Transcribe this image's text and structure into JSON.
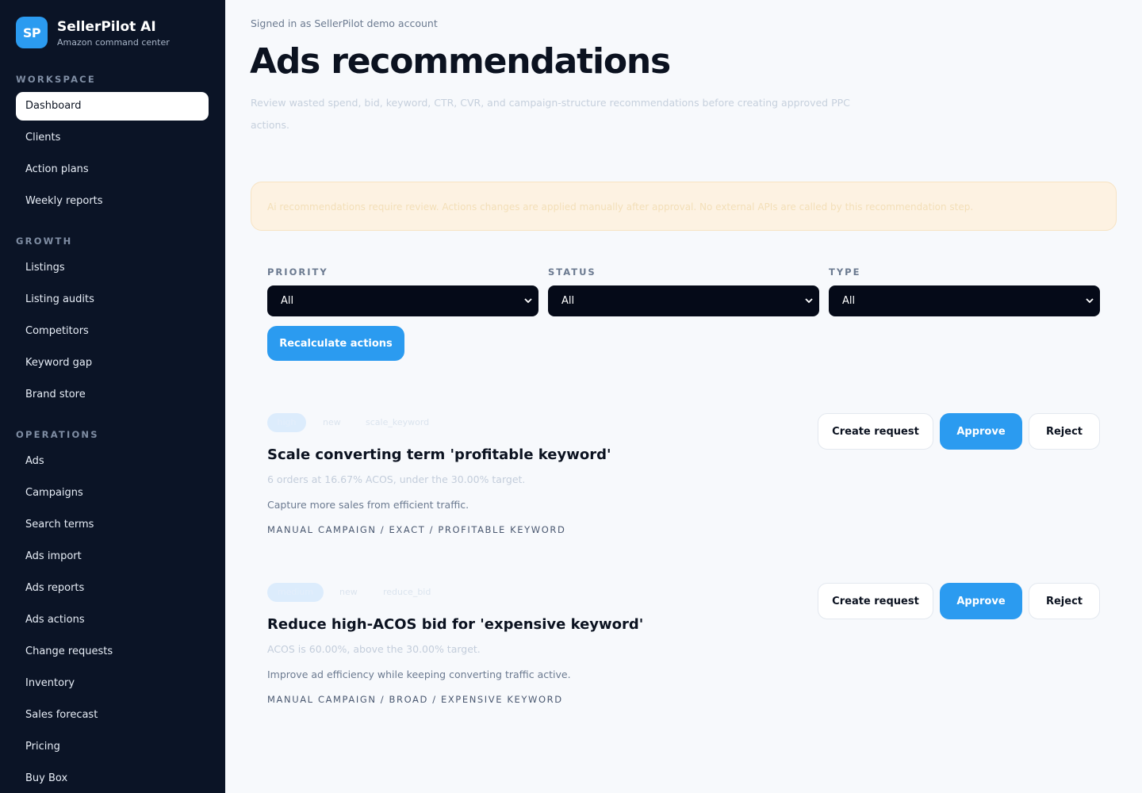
{
  "brand": {
    "logo": "SP",
    "name": "SellerPilot AI",
    "tagline": "Amazon command center"
  },
  "sidebar": {
    "sections": [
      {
        "heading": "WORKSPACE",
        "items": [
          "Dashboard",
          "Clients",
          "Action plans",
          "Weekly reports"
        ]
      },
      {
        "heading": "GROWTH",
        "items": [
          "Listings",
          "Listing audits",
          "Competitors",
          "Keyword gap",
          "Brand store"
        ]
      },
      {
        "heading": "OPERATIONS",
        "items": [
          "Ads",
          "Campaigns",
          "Search terms",
          "Ads import",
          "Ads reports",
          "Ads actions",
          "Change requests",
          "Inventory",
          "Sales forecast",
          "Pricing",
          "Buy Box"
        ]
      }
    ],
    "active": "Dashboard"
  },
  "header": {
    "signed_in": "Signed in as SellerPilot demo account",
    "title": "Ads recommendations",
    "description": "Review wasted spend, bid, keyword, CTR, CVR, and campaign-structure recommendations before creating approved PPC actions."
  },
  "warning": {
    "text": "Ai recommendations require review. Actions changes are applied manually after approval. No external APIs are called by this recommendation step."
  },
  "filters": [
    {
      "label": "PRIORITY",
      "value": "All"
    },
    {
      "label": "STATUS",
      "value": "All"
    },
    {
      "label": "TYPE",
      "value": "All"
    }
  ],
  "recalculate_label": "Recalculate actions",
  "recommendations": [
    {
      "priority": "high",
      "status": "new",
      "type": "scale_keyword",
      "title": "Scale converting term 'profitable keyword'",
      "metric": "6 orders at 16.67% ACOS, under the 30.00% target.",
      "goal": "Capture more sales from efficient traffic.",
      "path": "MANUAL CAMPAIGN / EXACT / PROFITABLE KEYWORD"
    },
    {
      "priority": "medium",
      "status": "new",
      "type": "reduce_bid",
      "title": "Reduce high-ACOS bid for 'expensive keyword'",
      "metric": "ACOS is 60.00%, above the 30.00% target.",
      "goal": "Improve ad efficiency while keeping converting traffic active.",
      "path": "MANUAL CAMPAIGN / BROAD / EXPENSIVE KEYWORD"
    }
  ],
  "action_buttons": {
    "create": "Create request",
    "approve": "Approve",
    "reject": "Reject"
  },
  "colors": {
    "sidebar_bg": "#0b1426",
    "accent": "#2b9bf0",
    "page_bg": "#f7f9fc",
    "warning_bg": "#fdf2e2"
  },
  "icons": {
    "select_chevron": "chevron-down-icon"
  }
}
